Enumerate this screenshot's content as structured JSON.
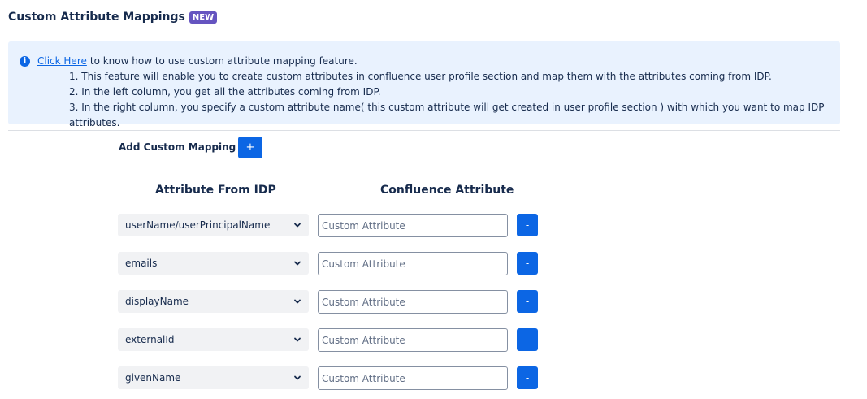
{
  "header": {
    "title": "Custom Attribute Mappings",
    "badge": "NEW"
  },
  "info": {
    "link_text": "Click Here",
    "lead_text": "to know how to use custom attribute mapping feature.",
    "items": [
      "1. This feature will enable you to create custom attributes in confluence user profile section and map them with the attributes coming from IDP.",
      "2. In the left column, you get all the attributes coming from IDP.",
      "3. In the right column, you specify a custom attribute name( this custom attribute will get created in user profile section ) with which you want to map IDP attributes."
    ]
  },
  "add_mapping": {
    "label": "Add Custom Mapping",
    "button_label": "+"
  },
  "columns": {
    "idp": "Attribute From IDP",
    "confluence": "Confluence Attribute"
  },
  "rows": [
    {
      "idp_value": "userName/userPrincipalName",
      "confluence_placeholder": "Custom Attribute",
      "remove_label": "-"
    },
    {
      "idp_value": "emails",
      "confluence_placeholder": "Custom Attribute",
      "remove_label": "-"
    },
    {
      "idp_value": "displayName",
      "confluence_placeholder": "Custom Attribute",
      "remove_label": "-"
    },
    {
      "idp_value": "externalId",
      "confluence_placeholder": "Custom Attribute",
      "remove_label": "-"
    },
    {
      "idp_value": "givenName",
      "confluence_placeholder": "Custom Attribute",
      "remove_label": "-"
    }
  ],
  "icons": {
    "info": "info-icon",
    "dropdown": "chevron-down-icon"
  },
  "colors": {
    "primary": "#0c66e4",
    "badge": "#6554c0",
    "info_bg": "#e9f2fe"
  }
}
